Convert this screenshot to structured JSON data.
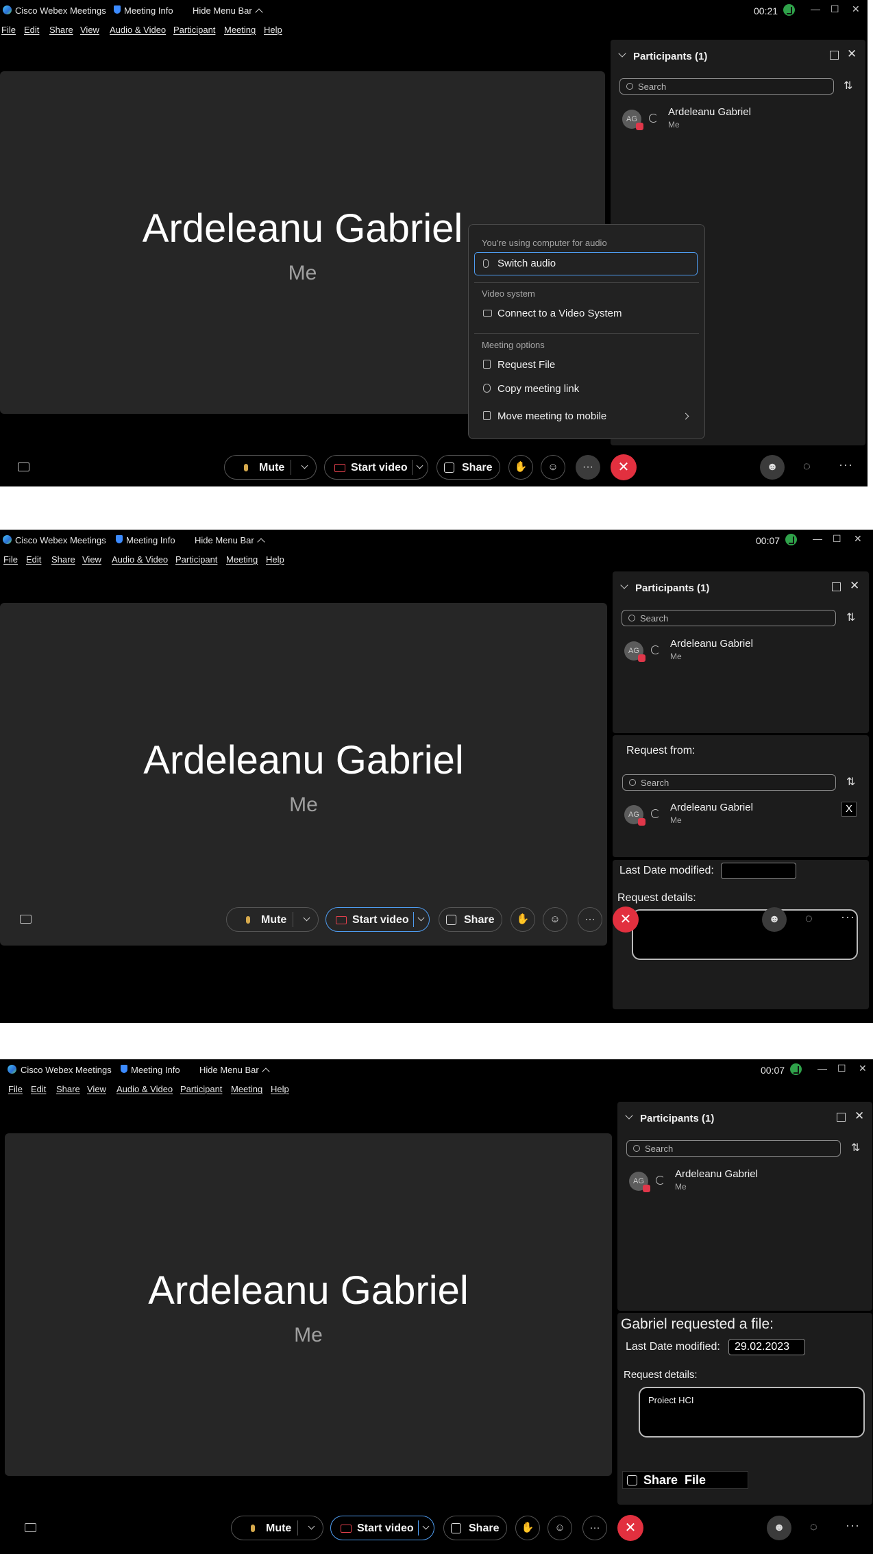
{
  "app": {
    "title": "Cisco Webex Meetings",
    "meeting_info": "Meeting Info",
    "hide_menu_bar": "Hide Menu Bar"
  },
  "menubar": [
    "File",
    "Edit",
    "Share",
    "View",
    "Audio & Video",
    "Participant",
    "Meeting",
    "Help"
  ],
  "screens": [
    {
      "timer": "00:21"
    },
    {
      "timer": "00:07"
    },
    {
      "timer": "00:07"
    }
  ],
  "stage": {
    "name": "Ardeleanu Gabriel",
    "me": "Me"
  },
  "participants": {
    "header": "Participants (1)",
    "search_placeholder": "Search",
    "items": [
      {
        "name": "Ardeleanu Gabriel",
        "role": "Me",
        "initials": "AG"
      }
    ]
  },
  "toolbar": {
    "mute": "Mute",
    "start_video": "Start video",
    "share": "Share",
    "end": "✕"
  },
  "more_menu": {
    "audio_section": "You're using computer for audio",
    "switch_audio": "Switch audio",
    "video_section": "Video system",
    "connect_video": "Connect to a Video System",
    "options_section": "Meeting options",
    "request_file": "Request File",
    "copy_link": "Copy meeting link",
    "move_mobile": "Move meeting to mobile"
  },
  "request_form": {
    "request_from": "Request from:",
    "search_placeholder": "Search",
    "participant": "Ardeleanu Gabriel",
    "participant_role": "Me",
    "remove": "X",
    "last_date_label": "Last Date modified:",
    "last_date_value": "",
    "details_label": "Request details:",
    "details_value": ""
  },
  "file_request": {
    "heading": "Gabriel requested a file:",
    "last_date_label": "Last Date modified:",
    "last_date_value": "29.02.2023",
    "details_label": "Request details:",
    "details_value": "Proiect HCI",
    "share_file": "Share  File"
  },
  "colors": {
    "end_call": "#e2303f",
    "accent": "#4e9cf0",
    "connected": "#2fa24a"
  }
}
